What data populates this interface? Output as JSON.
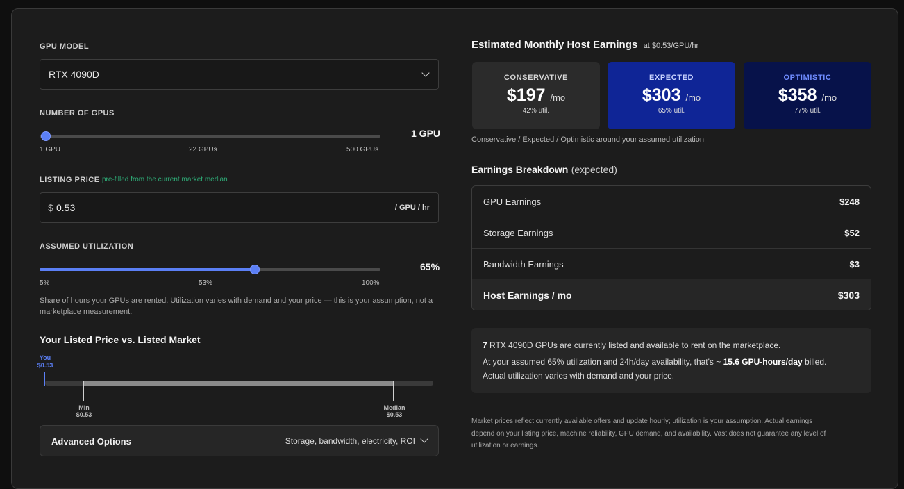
{
  "gpu_model": {
    "label": "GPU MODEL",
    "value": "RTX 4090D"
  },
  "num_gpus": {
    "label": "NUMBER OF GPUS",
    "value_display": "1 GPU",
    "min_label": "1 GPU",
    "mid_label": "22 GPUs",
    "max_label": "500 GPUs",
    "level": 0.0
  },
  "listing_price": {
    "label": "LISTING PRICE",
    "hint": "pre-filled from the current market median",
    "currency": "$",
    "value": "0.53",
    "unit": "/ GPU / hr"
  },
  "utilization": {
    "label": "ASSUMED UTILIZATION",
    "value_display": "65%",
    "min_label": "5%",
    "mid_label": "53%",
    "max_label": "100%",
    "level_percent": 65,
    "help_line1": "Share of hours your GPUs are rented. Utilization varies with demand and your price — this is your assumption, not a",
    "help_line2": "marketplace measurement."
  },
  "price_compare": {
    "title": "Your Listed Price vs. Listed Market",
    "you_label": "You",
    "you_value": "$0.53",
    "min_label": "Min",
    "min_value": "$0.53",
    "median_label": "Median",
    "median_value": "$0.53"
  },
  "advanced": {
    "title": "Advanced Options",
    "summary": "Storage, bandwidth, electricity, ROI"
  },
  "earnings": {
    "title": "Estimated Monthly Host Earnings",
    "rate_note": "at $0.53/GPU/hr",
    "per_label": "/mo",
    "scenarios": [
      {
        "label": "CONSERVATIVE",
        "amount": "$197",
        "util": "42% util."
      },
      {
        "label": "EXPECTED",
        "amount": "$303",
        "util": "65% util."
      },
      {
        "label": "OPTIMISTIC",
        "amount": "$358",
        "util": "77% util."
      }
    ],
    "scenario_note": "Conservative / Expected / Optimistic around your assumed utilization"
  },
  "breakdown": {
    "title": "Earnings Breakdown",
    "subtitle": "(expected)",
    "rows": [
      {
        "label": "GPU Earnings",
        "value": "$248"
      },
      {
        "label": "Storage Earnings",
        "value": "$52"
      },
      {
        "label": "Bandwidth Earnings",
        "value": "$3"
      }
    ],
    "total_label": "Host Earnings / mo",
    "total_value": "$303"
  },
  "info": {
    "count": "7",
    "line1_rest": " RTX 4090D GPUs are currently listed and available to rent on the marketplace.",
    "line2_pre": "At your assumed 65% utilization and 24h/day availability, that's ~ ",
    "line2_bold": "15.6 GPU-hours/day",
    "line2_post": " billed.",
    "line3": "Actual utilization varies with demand and your price."
  },
  "footnote": {
    "line1": "Market prices reflect currently available offers and update hourly; utilization is your assumption. Actual earnings",
    "line2": "depend on your listing price, machine reliability, GPU demand, and availability. Vast does not guarantee any level of",
    "line3": "utilization or earnings."
  },
  "colors": {
    "accent": "#5b7ff5",
    "expected_bg": "#0f2596",
    "optimistic_bg": "#07124a",
    "conservative_bg": "#2b2b2b",
    "hint_green": "#2fb07a"
  }
}
